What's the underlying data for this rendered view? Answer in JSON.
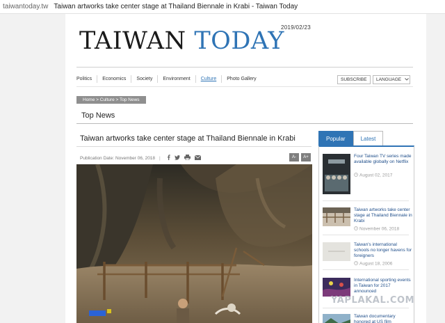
{
  "browser": {
    "domain": "taiwantoday.tw",
    "title": "Taiwan artworks take center stage at Thailand Biennale in Krabi - Taiwan Today"
  },
  "header": {
    "date": "2019/02/23",
    "logo_word1": "TAIWAN",
    "logo_word2": "TODAY"
  },
  "nav": {
    "items": [
      "Politics",
      "Economics",
      "Society",
      "Environment",
      "Culture",
      "Photo Gallery"
    ],
    "active": "Culture",
    "subscribe": "SUBSCRIBE",
    "language": "LANGUAGE"
  },
  "breadcrumb": "Home > Culture > Top News",
  "section_title": "Top News",
  "article": {
    "title": "Taiwan artworks take center stage at Thailand Biennale in Krabi",
    "pub_label": "Publication Date: November 06, 2018",
    "separator": "|",
    "font_smaller": "A-",
    "font_larger": "A+"
  },
  "sidebar": {
    "tabs": [
      "Popular",
      "Latest"
    ],
    "items": [
      {
        "title": "Four Taiwan TV series made available globally on Netflix",
        "date": "August 02, 2017"
      },
      {
        "title": "Taiwan artworks take center stage at Thailand Biennale in Krabi",
        "date": "November 06, 2018"
      },
      {
        "title": "Taiwan's international schools no longer havens for foreigners",
        "date": "August 18, 2006"
      },
      {
        "title": "International sporting events in Taiwan for 2017 announced",
        "date": ""
      },
      {
        "title": "Taiwan documentary honored at US film",
        "date": ""
      }
    ]
  },
  "watermark": "YAPLAKAL.COM",
  "colors": {
    "accent": "#2f74b5",
    "breadcrumb_bg": "#8f8f8f",
    "text": "#222222"
  },
  "icons": [
    "facebook-icon",
    "twitter-icon",
    "print-icon",
    "mail-icon",
    "dropdown-chevron-icon",
    "clock-icon"
  ]
}
